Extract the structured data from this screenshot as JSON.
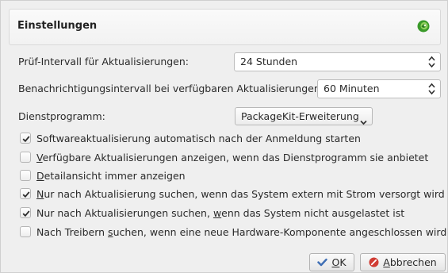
{
  "dialog": {
    "title": "Einstellungen",
    "title_icon": "apper-icon"
  },
  "settings": {
    "check_interval": {
      "label": "Prüf-Intervall für Aktualisierungen:",
      "value": "24 Stunden"
    },
    "notify_interval": {
      "label": "Benachrichtigungsintervall bei verfügbaren Aktualisierungen:",
      "value": "60 Minuten"
    },
    "helper": {
      "label": "Dienstprogramm:",
      "value": "PackageKit-Erweiterung"
    }
  },
  "checkboxes": [
    {
      "label_pre": "Softwareaktualisierung automatisch nach der Anmeldung starten",
      "mnemonic": "",
      "label_post": "",
      "checked": true
    },
    {
      "label_pre": "",
      "mnemonic": "V",
      "label_post": "erfügbare Aktualisierungen anzeigen, wenn das Dienstprogramm sie anbietet",
      "checked": false
    },
    {
      "label_pre": "",
      "mnemonic": "D",
      "label_post": "etailansicht immer anzeigen",
      "checked": false
    },
    {
      "label_pre": "",
      "mnemonic": "N",
      "label_post": "ur nach Aktualisierung suchen, wenn das System extern mit Strom versorgt wird",
      "checked": true
    },
    {
      "label_pre": "Nur nach Aktualisierungen suchen, ",
      "mnemonic": "w",
      "label_post": "enn das System nicht ausgelastet ist",
      "checked": true
    },
    {
      "label_pre": "Nach Treibern ",
      "mnemonic": "s",
      "label_post": "uchen, wenn eine neue Hardware-Komponente angeschlossen wird",
      "checked": false
    }
  ],
  "buttons": {
    "ok": {
      "mnemonic": "O",
      "rest": "K",
      "icon": "checkmark-icon"
    },
    "cancel": {
      "mnemonic": "A",
      "rest": "bbrechen",
      "icon": "cancel-icon"
    }
  },
  "colors": {
    "ok_icon": "#3f6fb5",
    "cancel_icon": "#d03b33",
    "logo_green": "#3a9a2a"
  }
}
